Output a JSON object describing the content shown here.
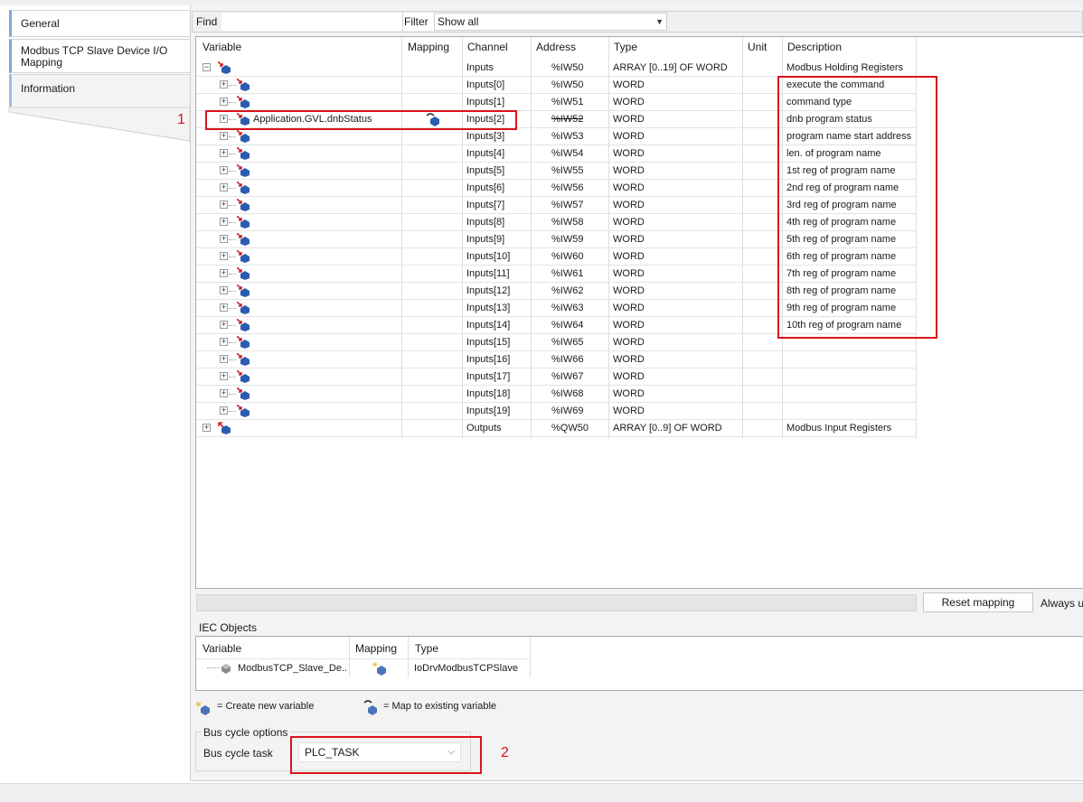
{
  "sidebar": {
    "tabs": [
      {
        "label": "General",
        "active": true
      },
      {
        "label_line1": "Modbus TCP Slave Device I/O",
        "label_line2": "Mapping",
        "active": true
      },
      {
        "label": "Information",
        "active": false
      }
    ]
  },
  "toolbar": {
    "find_label": "Find",
    "find_value": "",
    "filter_label": "Filter",
    "filter_value": "Show all"
  },
  "mapping_table": {
    "columns": [
      "Variable",
      "Mapping",
      "Channel",
      "Address",
      "Type",
      "Unit",
      "Description"
    ],
    "rows": [
      {
        "level": 0,
        "expander": "−",
        "variable": "",
        "mapping_icon": "",
        "channel": "Inputs",
        "address": "%IW50",
        "type": "ARRAY [0..19] OF WORD",
        "unit": "",
        "description": "Modbus Holding Registers"
      },
      {
        "level": 1,
        "expander": "+",
        "variable": "",
        "mapping_icon": "",
        "channel": "Inputs[0]",
        "address": "%IW50",
        "type": "WORD",
        "unit": "",
        "description": "execute the command"
      },
      {
        "level": 1,
        "expander": "+",
        "variable": "",
        "mapping_icon": "",
        "channel": "Inputs[1]",
        "address": "%IW51",
        "type": "WORD",
        "unit": "",
        "description": "command type"
      },
      {
        "level": 1,
        "expander": "+",
        "variable": "Application.GVL.dnbStatus",
        "mapping_icon": "map-existing-icon",
        "channel": "Inputs[2]",
        "address": "%IW52",
        "address_struck": true,
        "type": "WORD",
        "unit": "",
        "description": "dnb program status"
      },
      {
        "level": 1,
        "expander": "+",
        "variable": "",
        "mapping_icon": "",
        "channel": "Inputs[3]",
        "address": "%IW53",
        "type": "WORD",
        "unit": "",
        "description": "program name start address"
      },
      {
        "level": 1,
        "expander": "+",
        "variable": "",
        "mapping_icon": "",
        "channel": "Inputs[4]",
        "address": "%IW54",
        "type": "WORD",
        "unit": "",
        "description": "len. of program name"
      },
      {
        "level": 1,
        "expander": "+",
        "variable": "",
        "mapping_icon": "",
        "channel": "Inputs[5]",
        "address": "%IW55",
        "type": "WORD",
        "unit": "",
        "description": "1st reg of program name"
      },
      {
        "level": 1,
        "expander": "+",
        "variable": "",
        "mapping_icon": "",
        "channel": "Inputs[6]",
        "address": "%IW56",
        "type": "WORD",
        "unit": "",
        "description": "2nd  reg of program name"
      },
      {
        "level": 1,
        "expander": "+",
        "variable": "",
        "mapping_icon": "",
        "channel": "Inputs[7]",
        "address": "%IW57",
        "type": "WORD",
        "unit": "",
        "description": "3rd reg of program name"
      },
      {
        "level": 1,
        "expander": "+",
        "variable": "",
        "mapping_icon": "",
        "channel": "Inputs[8]",
        "address": "%IW58",
        "type": "WORD",
        "unit": "",
        "description": "4th reg of program name"
      },
      {
        "level": 1,
        "expander": "+",
        "variable": "",
        "mapping_icon": "",
        "channel": "Inputs[9]",
        "address": "%IW59",
        "type": "WORD",
        "unit": "",
        "description": "5th reg of program name"
      },
      {
        "level": 1,
        "expander": "+",
        "variable": "",
        "mapping_icon": "",
        "channel": "Inputs[10]",
        "address": "%IW60",
        "type": "WORD",
        "unit": "",
        "description": "6th reg of program name"
      },
      {
        "level": 1,
        "expander": "+",
        "variable": "",
        "mapping_icon": "",
        "channel": "Inputs[11]",
        "address": "%IW61",
        "type": "WORD",
        "unit": "",
        "description": "7th reg of program name"
      },
      {
        "level": 1,
        "expander": "+",
        "variable": "",
        "mapping_icon": "",
        "channel": "Inputs[12]",
        "address": "%IW62",
        "type": "WORD",
        "unit": "",
        "description": "8th reg of program name"
      },
      {
        "level": 1,
        "expander": "+",
        "variable": "",
        "mapping_icon": "",
        "channel": "Inputs[13]",
        "address": "%IW63",
        "type": "WORD",
        "unit": "",
        "description": "9th reg of program name"
      },
      {
        "level": 1,
        "expander": "+",
        "variable": "",
        "mapping_icon": "",
        "channel": "Inputs[14]",
        "address": "%IW64",
        "type": "WORD",
        "unit": "",
        "description": "10th reg of program name"
      },
      {
        "level": 1,
        "expander": "+",
        "variable": "",
        "mapping_icon": "",
        "channel": "Inputs[15]",
        "address": "%IW65",
        "type": "WORD",
        "unit": "",
        "description": ""
      },
      {
        "level": 1,
        "expander": "+",
        "variable": "",
        "mapping_icon": "",
        "channel": "Inputs[16]",
        "address": "%IW66",
        "type": "WORD",
        "unit": "",
        "description": ""
      },
      {
        "level": 1,
        "expander": "+",
        "variable": "",
        "mapping_icon": "",
        "channel": "Inputs[17]",
        "address": "%IW67",
        "type": "WORD",
        "unit": "",
        "description": ""
      },
      {
        "level": 1,
        "expander": "+",
        "variable": "",
        "mapping_icon": "",
        "channel": "Inputs[18]",
        "address": "%IW68",
        "type": "WORD",
        "unit": "",
        "description": ""
      },
      {
        "level": 1,
        "expander": "+",
        "variable": "",
        "mapping_icon": "",
        "channel": "Inputs[19]",
        "address": "%IW69",
        "type": "WORD",
        "unit": "",
        "description": ""
      },
      {
        "level": 0,
        "expander": "+",
        "variable": "",
        "mapping_icon": "",
        "channel": "Outputs",
        "address": "%QW50",
        "type": "ARRAY [0..9] OF WORD",
        "unit": "",
        "description": "Modbus Input Registers"
      }
    ]
  },
  "annotations": {
    "marker1": "1",
    "marker2": "2",
    "color": "#d8141a"
  },
  "actions": {
    "reset_mapping": "Reset mapping",
    "always_update": "Always up"
  },
  "iec_objects": {
    "title": "IEC Objects",
    "columns": [
      "Variable",
      "Mapping",
      "Type"
    ],
    "row": {
      "variable": "ModbusTCP_Slave_De...",
      "type": "IoDrvModbusTCPSlave"
    }
  },
  "legend": {
    "create_new": "= Create new variable",
    "map_existing": "= Map to existing variable"
  },
  "bus_cycle": {
    "legend": "Bus cycle options",
    "task_label": "Bus cycle task",
    "task_value": "PLC_TASK"
  },
  "colors": {
    "tab_accent": "#7fa8d6",
    "input_arrow_red": "#d0202a",
    "variable_blue": "#2a5db0"
  }
}
